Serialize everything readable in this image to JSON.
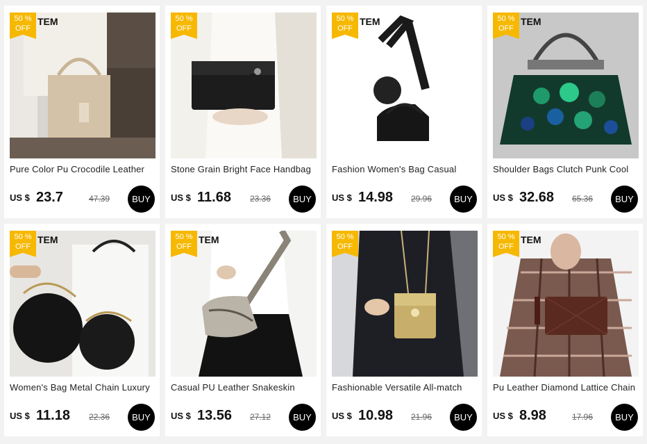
{
  "badge": {
    "percent": "50 %",
    "off": "OFF"
  },
  "tem_label": "TEM",
  "currency": "US $",
  "buy_label": "BUY",
  "products": [
    {
      "title": "Pure Color Pu Crocodile Leather",
      "price": "23.7",
      "old_price": "47.39",
      "image": "beige-croc-tote-photo"
    },
    {
      "title": "Stone Grain Bright Face Handbag",
      "price": "11.68",
      "old_price": "23.36",
      "image": "black-croc-clutch-photo"
    },
    {
      "title": "Fashion Women's Bag Casual",
      "price": "14.98",
      "old_price": "29.96",
      "image": "black-baguette-bag-photo"
    },
    {
      "title": "Shoulder Bags Clutch Punk Cool",
      "price": "32.68",
      "old_price": "65.36",
      "image": "sequin-evening-bag-photo"
    },
    {
      "title": "Women's Bag Metal Chain Luxury",
      "price": "11.18",
      "old_price": "22.36",
      "image": "quilted-round-bags-photo"
    },
    {
      "title": "Casual PU Leather Snakeskin",
      "price": "13.56",
      "old_price": "27.12",
      "image": "snakeskin-saddle-bag-photo"
    },
    {
      "title": "Fashionable Versatile All-match",
      "price": "10.98",
      "old_price": "21.96",
      "image": "gold-mini-bag-photo"
    },
    {
      "title": "Pu Leather Diamond Lattice Chain",
      "price": "8.98",
      "old_price": "17.96",
      "image": "brown-quilted-clutch-photo"
    }
  ]
}
